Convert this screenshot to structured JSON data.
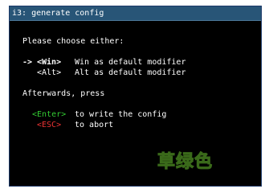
{
  "window": {
    "title": "i3: generate config"
  },
  "prompt": "Please choose either:",
  "options": [
    {
      "arrow": "->",
      "key": "<Win>",
      "description": "Win as default modifier"
    },
    {
      "arrow": "",
      "key": "<Alt>",
      "description": "Alt as default modifier"
    }
  ],
  "afterwards": "Afterwards, press",
  "actions": [
    {
      "key": "<Enter>",
      "description": "to write the config",
      "color": "#33cc33"
    },
    {
      "key": "<ESC>",
      "description": "to abort",
      "color": "#ee3333"
    }
  ],
  "watermark": "草绿色",
  "colors": {
    "titlebar": "#285577",
    "background": "#000000",
    "text": "#ffffff"
  }
}
